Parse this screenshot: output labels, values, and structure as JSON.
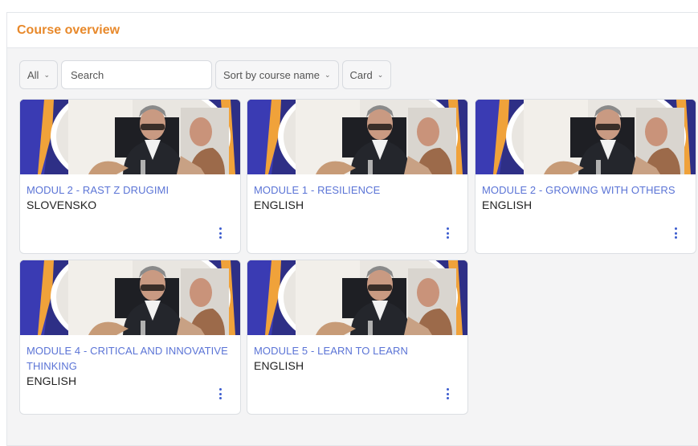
{
  "header": {
    "title": "Course overview"
  },
  "toolbar": {
    "filter_label": "All",
    "search_placeholder": "Search",
    "sort_label": "Sort by course name",
    "view_label": "Card"
  },
  "courses": [
    {
      "title": "MODUL 2 - RAST Z DRUGIMI",
      "language": "Slovensko"
    },
    {
      "title": "MODULE 1 - RESILIENCE",
      "language": "English"
    },
    {
      "title": "MODULE 2 - GROWING WITH OTHERS",
      "language": "English"
    },
    {
      "title": "MODULE 4 - CRITICAL AND INNOVATIVE THINKING",
      "language": "English"
    },
    {
      "title": "MODULE 5 - LEARN TO LEARN",
      "language": "English"
    }
  ],
  "colors": {
    "accent": "#e8892b",
    "link": "#5b74d6",
    "thumb_purple": "#3a3bb3",
    "thumb_orange": "#f0a23a"
  }
}
